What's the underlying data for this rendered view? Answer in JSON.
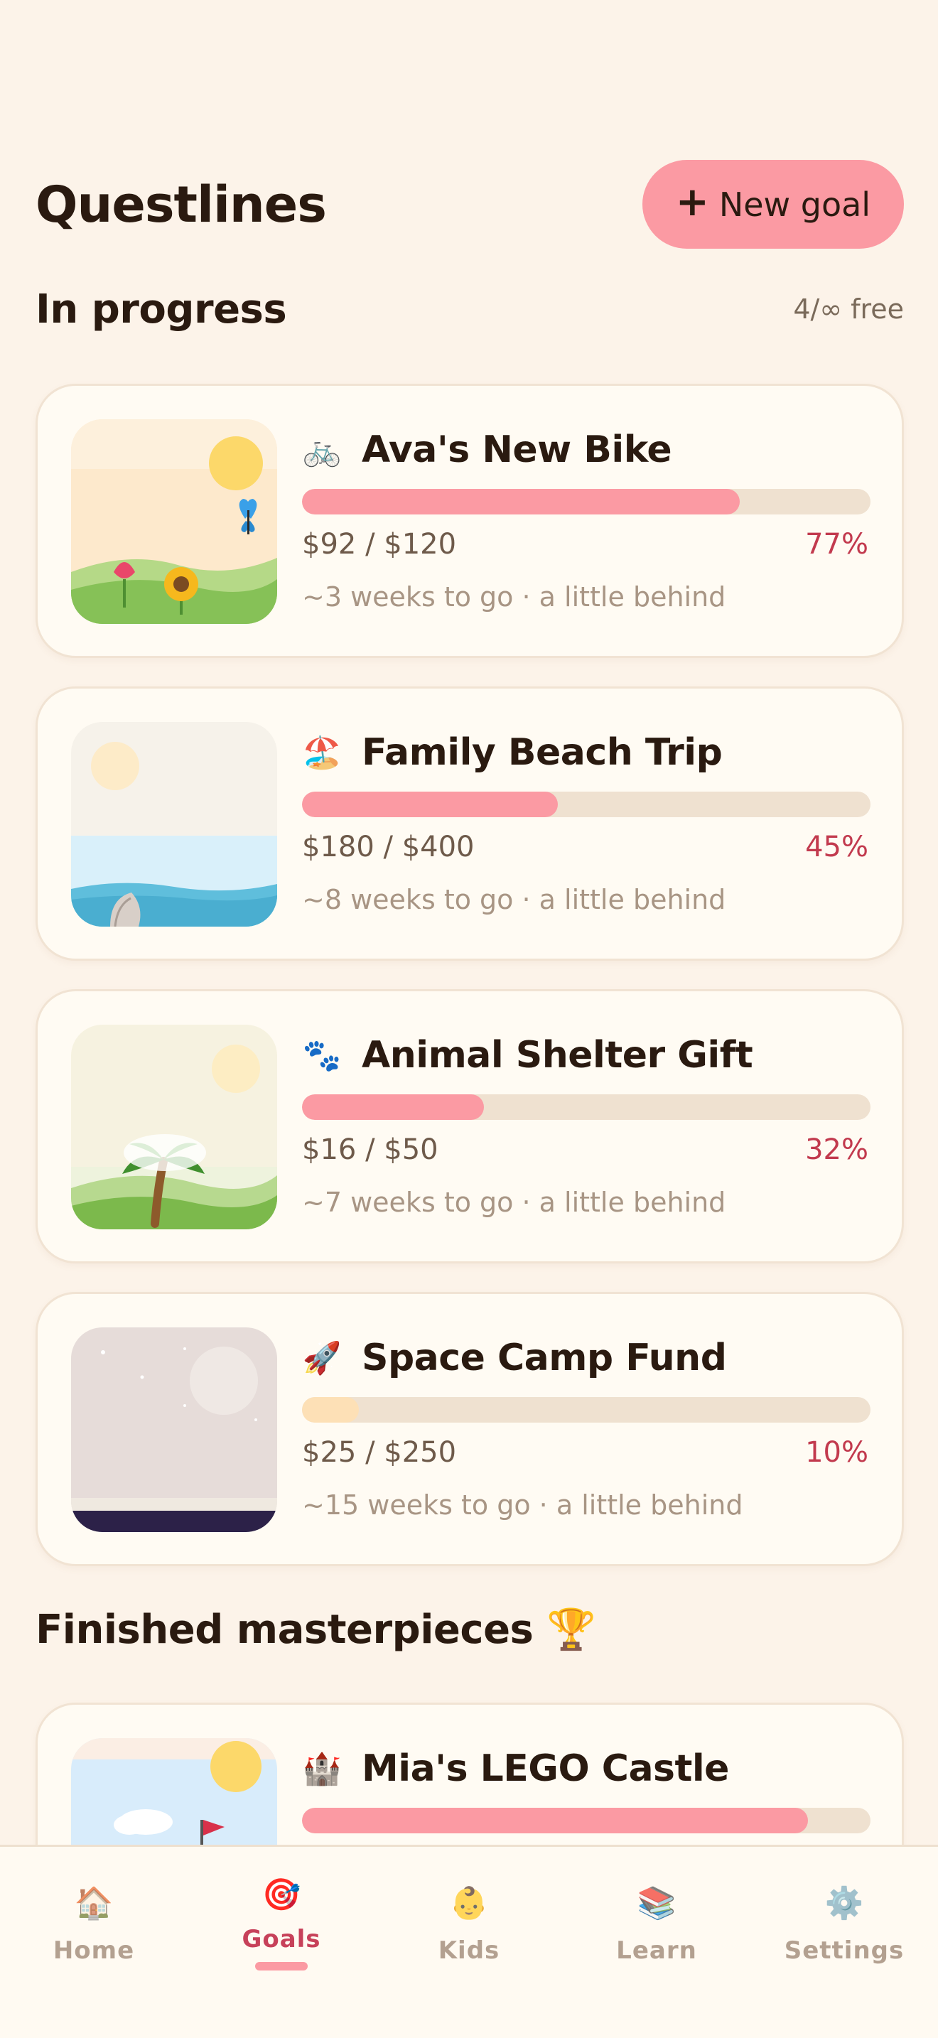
{
  "header": {
    "title": "Questlines",
    "new_goal_label": "New goal",
    "new_goal_icon": "plus-icon"
  },
  "in_progress": {
    "title": "In progress",
    "quota": "4/∞ free"
  },
  "goals": [
    {
      "emoji": "🚲",
      "name": "Ava's New Bike",
      "amount": "$92 / $120",
      "percent_label": "77%",
      "progress": 0.77,
      "eta": "~3 weeks to go · a little behind",
      "bar_color": "#fb9aa3"
    },
    {
      "emoji": "🏖️",
      "name": "Family Beach Trip",
      "amount": "$180 / $400",
      "percent_label": "45%",
      "progress": 0.45,
      "eta": "~8 weeks to go · a little behind",
      "bar_color": "#fb9aa3"
    },
    {
      "emoji": "🐾",
      "name": "Animal Shelter Gift",
      "amount": "$16 / $50",
      "percent_label": "32%",
      "progress": 0.32,
      "eta": "~7 weeks to go · a little behind",
      "bar_color": "#fb9aa3"
    },
    {
      "emoji": "🚀",
      "name": "Space Camp Fund",
      "amount": "$25 / $250",
      "percent_label": "10%",
      "progress": 0.1,
      "eta": "~15 weeks to go · a little behind",
      "bar_color": "#fde0b6"
    }
  ],
  "finished": {
    "title": "Finished masterpieces 🏆",
    "goals": [
      {
        "emoji": "🏰",
        "name": "Mia's LEGO Castle",
        "progress": 0.89,
        "bar_color": "#fb9aa3"
      }
    ]
  },
  "tabbar": {
    "items": [
      {
        "label": "Home",
        "icon": "🏠",
        "icon_name": "house-icon"
      },
      {
        "label": "Goals",
        "icon": "🎯",
        "icon_name": "target-icon"
      },
      {
        "label": "Kids",
        "icon": "👶",
        "icon_name": "kid-face-icon"
      },
      {
        "label": "Learn",
        "icon": "📚",
        "icon_name": "books-icon"
      },
      {
        "label": "Settings",
        "icon": "⚙️",
        "icon_name": "gear-icon"
      }
    ],
    "active": "Goals"
  },
  "colors": {
    "background": "#fcf3e9",
    "accent": "#fb9aa3",
    "percent": "#c23a4e",
    "active_tab": "#c7415a"
  }
}
